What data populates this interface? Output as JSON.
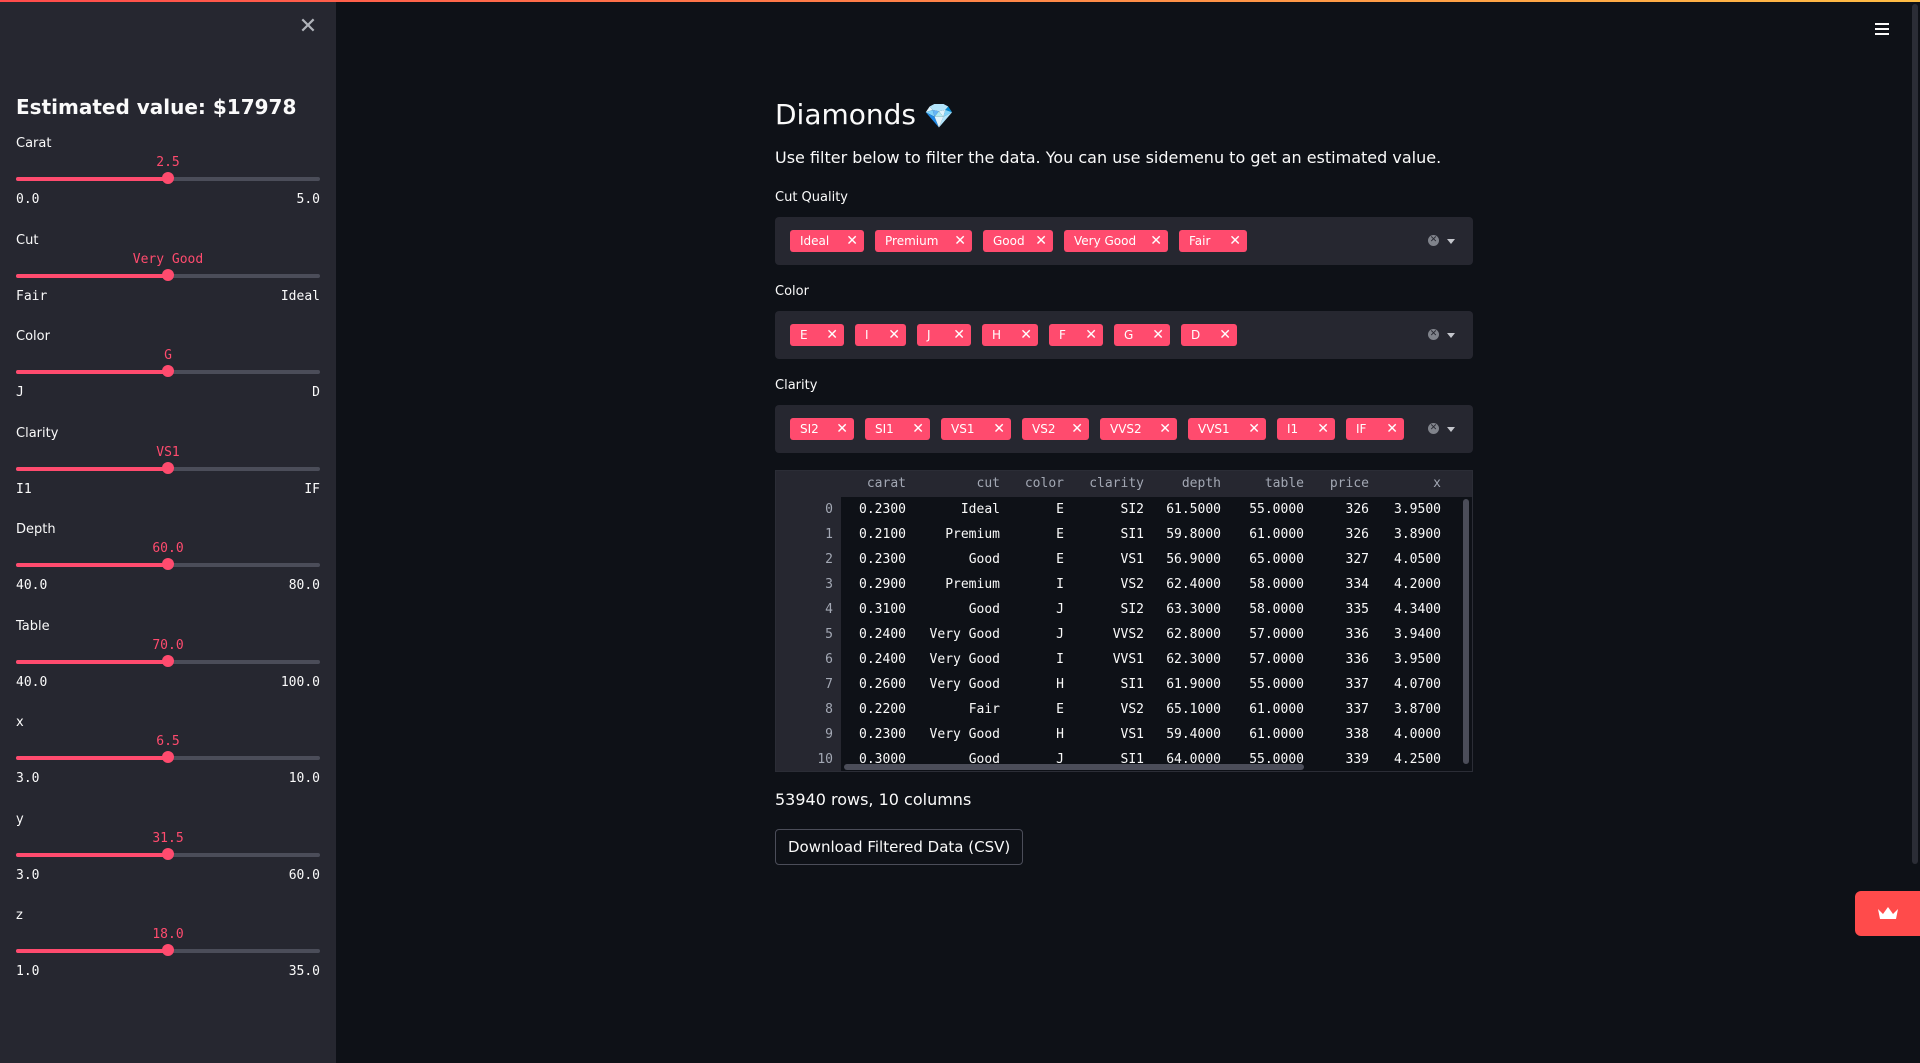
{
  "sidebar": {
    "estimated_value": "Estimated value: $17978",
    "sliders": [
      {
        "label": "Carat",
        "value": "2.5",
        "min": "0.0",
        "max": "5.0",
        "fraction": 0.5
      },
      {
        "label": "Cut",
        "value": "Very Good",
        "min": "Fair",
        "max": "Ideal",
        "fraction": 0.5
      },
      {
        "label": "Color",
        "value": "G",
        "min": "J",
        "max": "D",
        "fraction": 0.5
      },
      {
        "label": "Clarity",
        "value": "VS1",
        "min": "I1",
        "max": "IF",
        "fraction": 0.5
      },
      {
        "label": "Depth",
        "value": "60.0",
        "min": "40.0",
        "max": "80.0",
        "fraction": 0.5
      },
      {
        "label": "Table",
        "value": "70.0",
        "min": "40.0",
        "max": "100.0",
        "fraction": 0.5
      },
      {
        "label": "x",
        "value": "6.5",
        "min": "3.0",
        "max": "10.0",
        "fraction": 0.5
      },
      {
        "label": "y",
        "value": "31.5",
        "min": "3.0",
        "max": "60.0",
        "fraction": 0.5
      },
      {
        "label": "z",
        "value": "18.0",
        "min": "1.0",
        "max": "35.0",
        "fraction": 0.5
      }
    ]
  },
  "main": {
    "title": "Diamonds",
    "title_emoji": "💎",
    "description": "Use filter below to filter the data. You can use sidemenu to get an estimated value.",
    "filters": [
      {
        "label": "Cut Quality",
        "tags": [
          "Ideal",
          "Premium",
          "Good",
          "Very Good",
          "Fair"
        ]
      },
      {
        "label": "Color",
        "tags": [
          "E",
          "I",
          "J",
          "H",
          "F",
          "G",
          "D"
        ]
      },
      {
        "label": "Clarity",
        "tags": [
          "SI2",
          "SI1",
          "VS1",
          "VS2",
          "VVS2",
          "VVS1",
          "I1",
          "IF"
        ]
      }
    ],
    "table": {
      "columns": [
        "carat",
        "cut",
        "color",
        "clarity",
        "depth",
        "table",
        "price",
        "x"
      ],
      "rows": [
        [
          "0",
          "0.2300",
          "Ideal",
          "E",
          "SI2",
          "61.5000",
          "55.0000",
          "326",
          "3.9500"
        ],
        [
          "1",
          "0.2100",
          "Premium",
          "E",
          "SI1",
          "59.8000",
          "61.0000",
          "326",
          "3.8900"
        ],
        [
          "2",
          "0.2300",
          "Good",
          "E",
          "VS1",
          "56.9000",
          "65.0000",
          "327",
          "4.0500"
        ],
        [
          "3",
          "0.2900",
          "Premium",
          "I",
          "VS2",
          "62.4000",
          "58.0000",
          "334",
          "4.2000"
        ],
        [
          "4",
          "0.3100",
          "Good",
          "J",
          "SI2",
          "63.3000",
          "58.0000",
          "335",
          "4.3400"
        ],
        [
          "5",
          "0.2400",
          "Very Good",
          "J",
          "VVS2",
          "62.8000",
          "57.0000",
          "336",
          "3.9400"
        ],
        [
          "6",
          "0.2400",
          "Very Good",
          "I",
          "VVS1",
          "62.3000",
          "57.0000",
          "336",
          "3.9500"
        ],
        [
          "7",
          "0.2600",
          "Very Good",
          "H",
          "SI1",
          "61.9000",
          "55.0000",
          "337",
          "4.0700"
        ],
        [
          "8",
          "0.2200",
          "Fair",
          "E",
          "VS2",
          "65.1000",
          "61.0000",
          "337",
          "3.8700"
        ],
        [
          "9",
          "0.2300",
          "Very Good",
          "H",
          "VS1",
          "59.4000",
          "61.0000",
          "338",
          "4.0000"
        ],
        [
          "10",
          "0.3000",
          "Good",
          "J",
          "SI1",
          "64.0000",
          "55.0000",
          "339",
          "4.2500"
        ]
      ]
    },
    "row_count": "53940 rows, 10 columns",
    "download_label": "Download Filtered Data (CSV)"
  },
  "colors": {
    "accent": "#ff4b6e",
    "background": "#0e1117",
    "sidebar": "#262730"
  }
}
